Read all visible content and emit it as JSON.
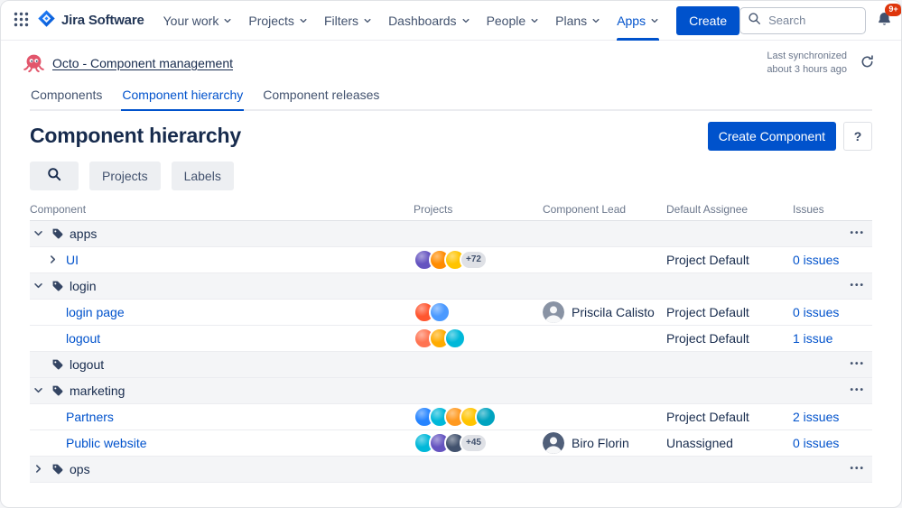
{
  "theme": {
    "accent": "#0052CC",
    "link": "#0052CC",
    "notification_red": "#DE350B",
    "text": "#172B4D",
    "subtle_text": "#6B778C",
    "group_row_bg": "#F4F5F7",
    "border": "#EBECF0"
  },
  "icons": {
    "app_switcher": "grid-dots",
    "search": "magnifier",
    "notifications": "bell",
    "help": "?",
    "settings": "⚙",
    "sync": "refresh",
    "more": "•••",
    "tag": "tag",
    "chevron_down": "chevron-down",
    "chevron_right": "chevron-right"
  },
  "topnav": {
    "brand": "Jira Software",
    "items": [
      {
        "label": "Your work",
        "active": false
      },
      {
        "label": "Projects",
        "active": false
      },
      {
        "label": "Filters",
        "active": false
      },
      {
        "label": "Dashboards",
        "active": false
      },
      {
        "label": "People",
        "active": false
      },
      {
        "label": "Plans",
        "active": false
      },
      {
        "label": "Apps",
        "active": true
      }
    ],
    "create_label": "Create",
    "search_placeholder": "Search",
    "notification_count": "9+"
  },
  "app_header": {
    "app_title": "Octo - Component management",
    "sync_line1": "Last synchronized",
    "sync_line2": "about 3 hours ago"
  },
  "tabs": [
    {
      "label": "Components",
      "active": false
    },
    {
      "label": "Component hierarchy",
      "active": true
    },
    {
      "label": "Component releases",
      "active": false
    }
  ],
  "page_header": {
    "title": "Component hierarchy",
    "create_component_label": "Create Component"
  },
  "filters": {
    "projects": "Projects",
    "labels": "Labels"
  },
  "table": {
    "headers": {
      "component": "Component",
      "projects": "Projects",
      "lead": "Component Lead",
      "assignee": "Default Assignee",
      "issues": "Issues"
    },
    "rows": [
      {
        "type": "group",
        "name": "apps",
        "expander": "down"
      },
      {
        "type": "child",
        "name": "UI",
        "expander": "right",
        "project_avatars": [
          "#6554C0",
          "#FF8B00",
          "#FFC400"
        ],
        "avatar_overflow": "+72",
        "lead": null,
        "assignee": "Project Default",
        "issues": "0 issues"
      },
      {
        "type": "group",
        "name": "login",
        "expander": "down"
      },
      {
        "type": "child",
        "name": "login page",
        "expander": null,
        "project_avatars": [
          "#FF5630",
          "#4C9AFF"
        ],
        "avatar_overflow": null,
        "lead": {
          "name": "Priscila Calisto",
          "avatar_color": "#8993A4"
        },
        "assignee": "Project Default",
        "issues": "0 issues"
      },
      {
        "type": "child",
        "name": "logout",
        "expander": null,
        "project_avatars": [
          "#FF7452",
          "#FFAB00",
          "#00B8D9"
        ],
        "avatar_overflow": null,
        "lead": null,
        "assignee": "Project Default",
        "issues": "1 issue"
      },
      {
        "type": "group",
        "name": "logout",
        "expander": null
      },
      {
        "type": "group",
        "name": "marketing",
        "expander": "down"
      },
      {
        "type": "child",
        "name": "Partners",
        "expander": null,
        "project_avatars": [
          "#2684FF",
          "#00B8D9",
          "#FF991F",
          "#FFC400",
          "#00A3BF"
        ],
        "avatar_overflow": null,
        "lead": null,
        "assignee": "Project Default",
        "issues": "2 issues"
      },
      {
        "type": "child",
        "name": "Public website",
        "expander": null,
        "project_avatars": [
          "#00B8D9",
          "#6554C0",
          "#42526E"
        ],
        "avatar_overflow": "+45",
        "lead": {
          "name": "Biro Florin",
          "avatar_color": "#505F79"
        },
        "assignee": "Unassigned",
        "issues": "0 issues"
      },
      {
        "type": "group",
        "name": "ops",
        "expander": "right"
      }
    ]
  }
}
